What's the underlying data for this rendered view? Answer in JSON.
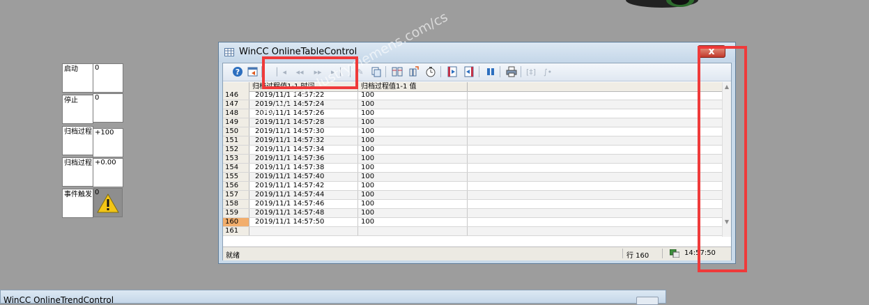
{
  "left_panel": {
    "buttons": [
      {
        "label": "启动",
        "value": "0"
      },
      {
        "label": "停止",
        "value": "0"
      },
      {
        "label": "归档过程",
        "value": "+100"
      },
      {
        "label": "归档过程",
        "value": "+0.00"
      },
      {
        "label": "事件触发",
        "value": "0"
      }
    ]
  },
  "window": {
    "title": "WinCC OnlineTableControl",
    "close_symbol": "x",
    "toolbar": {
      "icons": [
        "help-icon",
        "config-icon",
        "first-record-icon",
        "prev-record-icon",
        "next-record-icon",
        "last-record-icon",
        "edit-icon",
        "copy-icon",
        "select-archive-icon",
        "select-columns-icon",
        "time-range-icon",
        "previous-column-icon",
        "next-column-icon",
        "stop-icon",
        "print-icon",
        "export-icon",
        "statistics-icon"
      ]
    },
    "table": {
      "headers": [
        "",
        "归档过程值1-1 时间",
        "归档过程值1-1 值",
        ""
      ],
      "rows": [
        {
          "n": "146",
          "time": "2019/11/1 14:57:22",
          "value": "100"
        },
        {
          "n": "147",
          "time": "2019/11/1 14:57:24",
          "value": "100"
        },
        {
          "n": "148",
          "time": "2019/11/1 14:57:26",
          "value": "100"
        },
        {
          "n": "149",
          "time": "2019/11/1 14:57:28",
          "value": "100"
        },
        {
          "n": "150",
          "time": "2019/11/1 14:57:30",
          "value": "100"
        },
        {
          "n": "151",
          "time": "2019/11/1 14:57:32",
          "value": "100"
        },
        {
          "n": "152",
          "time": "2019/11/1 14:57:34",
          "value": "100"
        },
        {
          "n": "153",
          "time": "2019/11/1 14:57:36",
          "value": "100"
        },
        {
          "n": "154",
          "time": "2019/11/1 14:57:38",
          "value": "100"
        },
        {
          "n": "155",
          "time": "2019/11/1 14:57:40",
          "value": "100"
        },
        {
          "n": "156",
          "time": "2019/11/1 14:57:42",
          "value": "100"
        },
        {
          "n": "157",
          "time": "2019/11/1 14:57:44",
          "value": "100"
        },
        {
          "n": "158",
          "time": "2019/11/1 14:57:46",
          "value": "100"
        },
        {
          "n": "159",
          "time": "2019/11/1 14:57:48",
          "value": "100"
        },
        {
          "n": "160",
          "time": "2019/11/1 14:57:50",
          "value": "100"
        },
        {
          "n": "161",
          "time": "",
          "value": ""
        }
      ],
      "selected_row": "160"
    },
    "status": {
      "ready": "就绪",
      "row_label": "行 160",
      "time": "14:57:50"
    }
  },
  "watermark": "support.industry.siemens.com/cs",
  "bottom_window": {
    "title": "WinCC OnlineTrendControl"
  }
}
